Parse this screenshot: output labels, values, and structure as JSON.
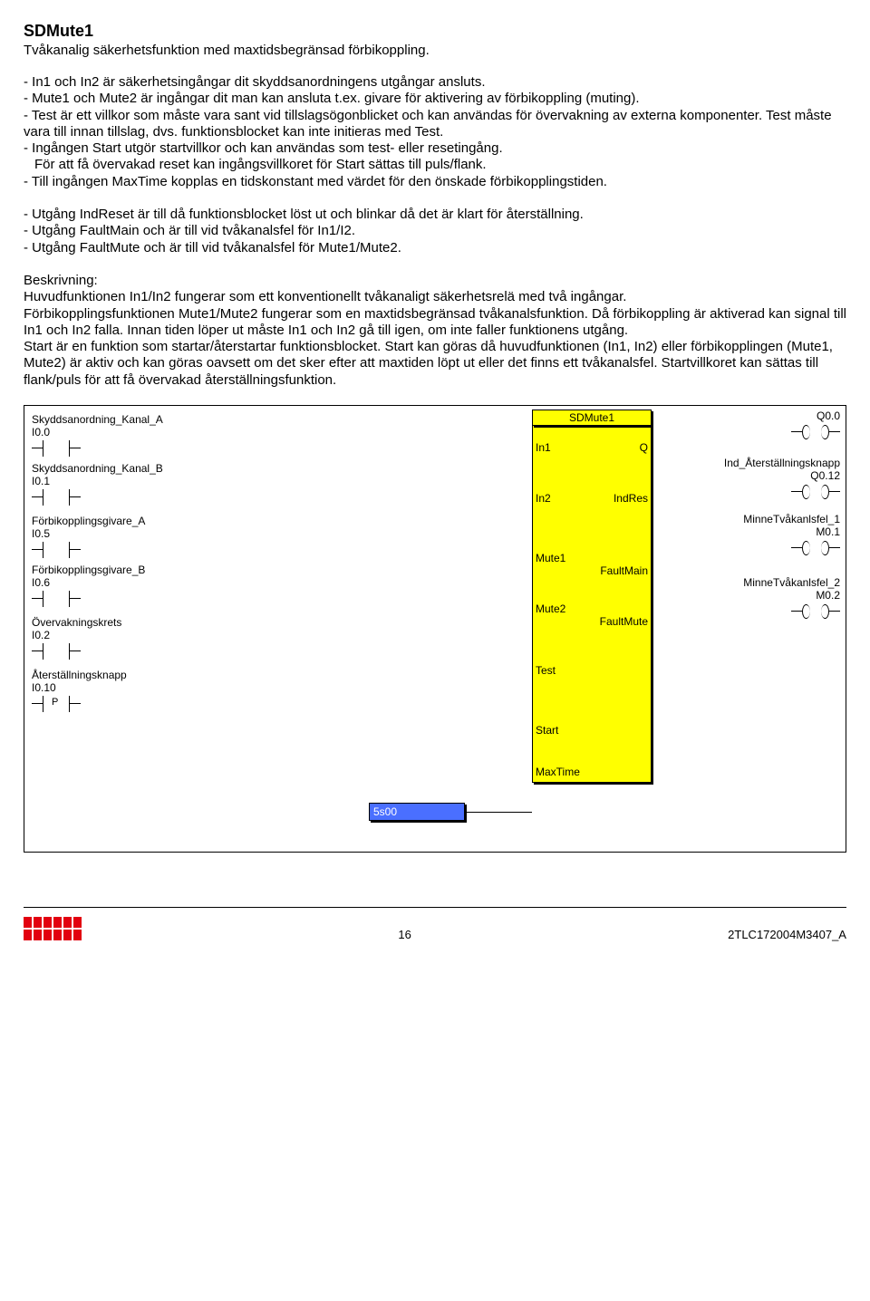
{
  "title": "SDMute1",
  "subtitle": "Tvåkanalig säkerhetsfunktion med maxtidsbegränsad förbikoppling.",
  "p1_l1": "- In1 och In2 är säkerhetsingångar dit skyddsanordningens utgångar ansluts.",
  "p1_l2": "- Mute1 och Mute2 är ingångar dit man kan ansluta t.ex. givare för aktivering av förbikoppling (muting).",
  "p1_l3": "- Test är ett villkor som måste vara sant vid tillslagsögonblicket och kan användas för övervakning av externa komponenter. Test måste vara till innan tillslag, dvs. funktionsblocket kan inte initieras med Test.",
  "p1_l4": "- Ingången Start utgör startvillkor och kan användas som test- eller resetingång.",
  "p1_l4b": "För att få övervakad reset kan ingångsvillkoret för Start sättas till puls/flank.",
  "p1_l5": "- Till ingången MaxTime kopplas en tidskonstant med värdet för den önskade förbikopplingstiden.",
  "p2_l1": "- Utgång IndReset är till då funktionsblocket löst ut och blinkar då det är klart för återställning.",
  "p2_l2": "- Utgång FaultMain och är till vid tvåkanalsfel för In1/I2.",
  "p2_l3": "- Utgång FaultMute och är till vid tvåkanalsfel för Mute1/Mute2.",
  "desc_h": "Beskrivning:",
  "desc_1": "Huvudfunktionen In1/In2 fungerar som ett konventionellt tvåkanaligt säkerhetsrelä med två ingångar.",
  "desc_2": "Förbikopplingsfunktionen Mute1/Mute2 fungerar som en maxtidsbegränsad tvåkanalsfunktion. Då förbikoppling är aktiverad kan signal till In1 och In2 falla. Innan tiden löper ut måste In1 och In2 gå till igen, om inte faller funktionens utgång.",
  "desc_3": "Start är en funktion som startar/återstartar funktionsblocket. Start kan göras då huvudfunktionen (In1, In2) eller förbikopplingen (Mute1, Mute2) är aktiv och kan göras oavsett om det sker efter att maxtiden löpt ut eller det finns ett tvåkanalsfel. Startvillkoret kan sättas till flank/puls för att få övervakad återställningsfunktion.",
  "inputs": [
    {
      "name": "Skyddsanordning_Kanal_A",
      "addr": "I0.0",
      "p": false
    },
    {
      "name": "Skyddsanordning_Kanal_B",
      "addr": "I0.1",
      "p": false
    },
    {
      "name": "Förbikopplingsgivare_A",
      "addr": "I0.5",
      "p": false
    },
    {
      "name": "Förbikopplingsgivare_B",
      "addr": "I0.6",
      "p": false
    },
    {
      "name": "Övervakningskrets",
      "addr": "I0.2",
      "p": false
    },
    {
      "name": "Återställningsknapp",
      "addr": "I0.10",
      "p": true
    }
  ],
  "outputs": [
    {
      "name": "",
      "addr": "Q0.0"
    },
    {
      "name": "Ind_Återställningsknapp",
      "addr": "Q0.12"
    },
    {
      "name": "MinneTvåkanlsfel_1",
      "addr": "M0.1"
    },
    {
      "name": "MinneTvåkanlsfel_2",
      "addr": "M0.2"
    }
  ],
  "fb": {
    "title": "SDMute1",
    "pins_left": [
      "In1",
      "In2",
      "Mute1",
      "Mute2",
      "Test",
      "Start",
      "MaxTime"
    ],
    "pins_right": [
      "Q",
      "IndRes",
      "FaultMain",
      "FaultMute"
    ]
  },
  "maxtime_val": "5s00",
  "pulse": "P",
  "footer_page": "16",
  "footer_doc": "2TLC172004M3407_A"
}
